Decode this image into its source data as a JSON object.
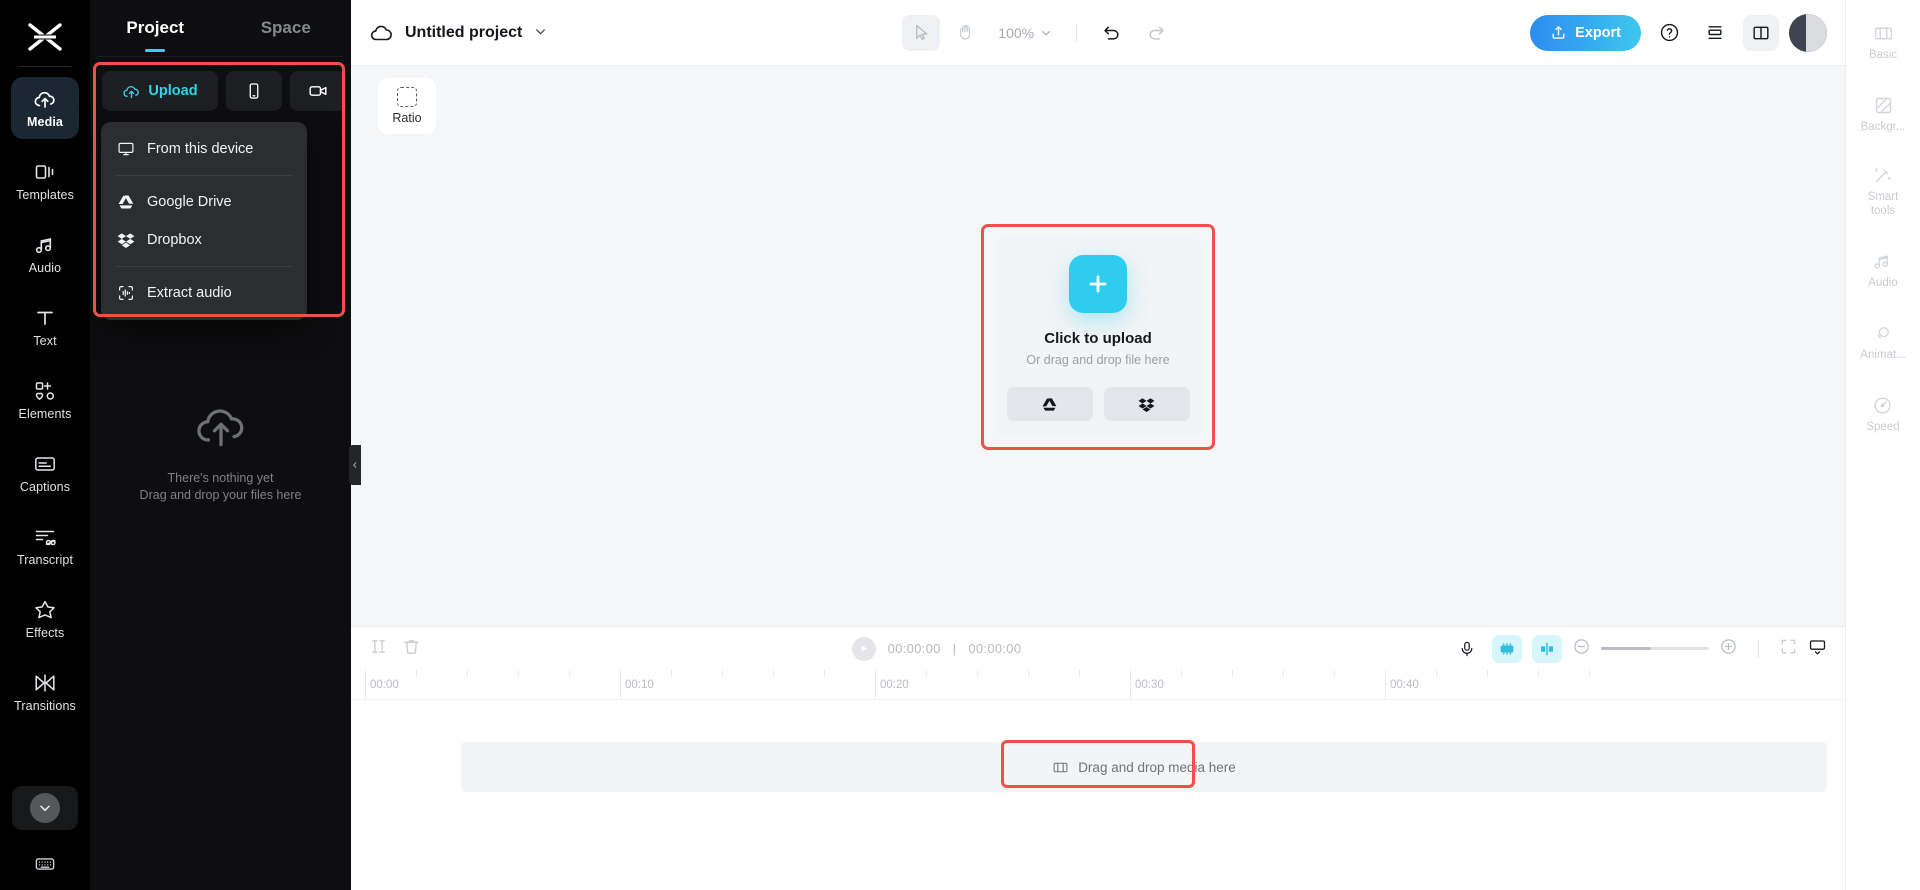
{
  "app": {
    "brand": "capcut-logo"
  },
  "rail": {
    "items": [
      {
        "label": "Media",
        "icon": "cloud-upload-icon",
        "active": true
      },
      {
        "label": "Templates",
        "icon": "templates-icon",
        "active": false
      },
      {
        "label": "Audio",
        "icon": "music-note-icon",
        "active": false
      },
      {
        "label": "Text",
        "icon": "text-t-icon",
        "active": false
      },
      {
        "label": "Elements",
        "icon": "elements-icon",
        "active": false
      },
      {
        "label": "Captions",
        "icon": "captions-icon",
        "active": false
      },
      {
        "label": "Transcript",
        "icon": "transcript-icon",
        "active": false
      },
      {
        "label": "Effects",
        "icon": "effects-star-icon",
        "active": false
      },
      {
        "label": "Transitions",
        "icon": "transitions-icon",
        "active": false
      }
    ],
    "collapse_icon": "chevron-down-icon",
    "keyboard_icon": "keyboard-icon"
  },
  "panel": {
    "tabs": [
      {
        "label": "Project",
        "active": true
      },
      {
        "label": "Space",
        "active": false
      }
    ],
    "upload_label": "Upload",
    "upload_icon": "cloud-upload-icon",
    "device_icon": "phone-icon",
    "record_icon": "camera-icon",
    "menu": [
      {
        "label": "From this device",
        "icon": "monitor-icon"
      },
      {
        "label": "Google Drive",
        "icon": "google-drive-icon"
      },
      {
        "label": "Dropbox",
        "icon": "dropbox-icon"
      },
      {
        "label": "Extract audio",
        "icon": "extract-audio-icon"
      }
    ],
    "empty_title": "There's nothing yet",
    "empty_sub": "Drag and drop your files here",
    "empty_icon": "cloud-upload-icon",
    "drag_handle_icon": "chevron-left-icon"
  },
  "topbar": {
    "cloud_icon": "cloud-icon",
    "project_name": "Untitled project",
    "project_chevron": "chevron-down-icon",
    "select_tool_icon": "cursor-arrow-icon",
    "hand_tool_icon": "hand-icon",
    "zoom_level": "100%",
    "zoom_chevron": "chevron-down-icon",
    "undo_icon": "undo-icon",
    "redo_icon": "redo-icon",
    "export_label": "Export",
    "export_icon": "export-upload-icon",
    "help_icon": "question-circle-icon",
    "layout_icon": "layout-rows-icon",
    "panel_toggle_icon": "split-panel-icon",
    "avatar_icon": "avatar"
  },
  "canvas": {
    "ratio_label": "Ratio",
    "ratio_icon": "dashed-square-icon",
    "plus_icon": "plus-icon",
    "title": "Click to upload",
    "subtitle": "Or drag and drop file here",
    "buttons": [
      {
        "icon": "google-drive-icon",
        "name": "google-drive"
      },
      {
        "icon": "dropbox-icon",
        "name": "dropbox"
      }
    ]
  },
  "timeline": {
    "split_icon": "split-icon",
    "delete_icon": "trash-icon",
    "play_icon": "play-icon",
    "current_time": "00:00:00",
    "time_separator": "|",
    "total_time": "00:00:00",
    "mic_icon": "microphone-icon",
    "autocut_icon": "auto-adjust-icon",
    "snap_icon": "snap-icon",
    "zoom_out_icon": "minus-circle-icon",
    "zoom_in_icon": "plus-circle-icon",
    "fit_icon": "fit-screen-icon",
    "display_icon": "monitor-dropdown-icon",
    "ruler_labels": [
      "00:00",
      "00:10",
      "00:20",
      "00:30",
      "00:40"
    ],
    "dropzone_label": "Drag and drop media here",
    "dropzone_icon": "film-strip-icon"
  },
  "right_rail": {
    "items": [
      {
        "label": "Basic",
        "icon": "film-basic-icon"
      },
      {
        "label": "Backgr...",
        "icon": "background-icon"
      },
      {
        "label": "Smart\ntools",
        "icon": "magic-wand-icon"
      },
      {
        "label": "Audio",
        "icon": "music-note-icon"
      },
      {
        "label": "Animat...",
        "icon": "animation-icon"
      },
      {
        "label": "Speed",
        "icon": "speed-gauge-icon"
      }
    ]
  },
  "colors": {
    "accent_cyan": "#2fd6e8",
    "highlight_red": "#f0504a",
    "export_gradient_start": "#2d8cf0",
    "export_gradient_end": "#3ec6ef",
    "panel_dark": "#0e0e10",
    "menu_dark": "#2b2d31"
  }
}
